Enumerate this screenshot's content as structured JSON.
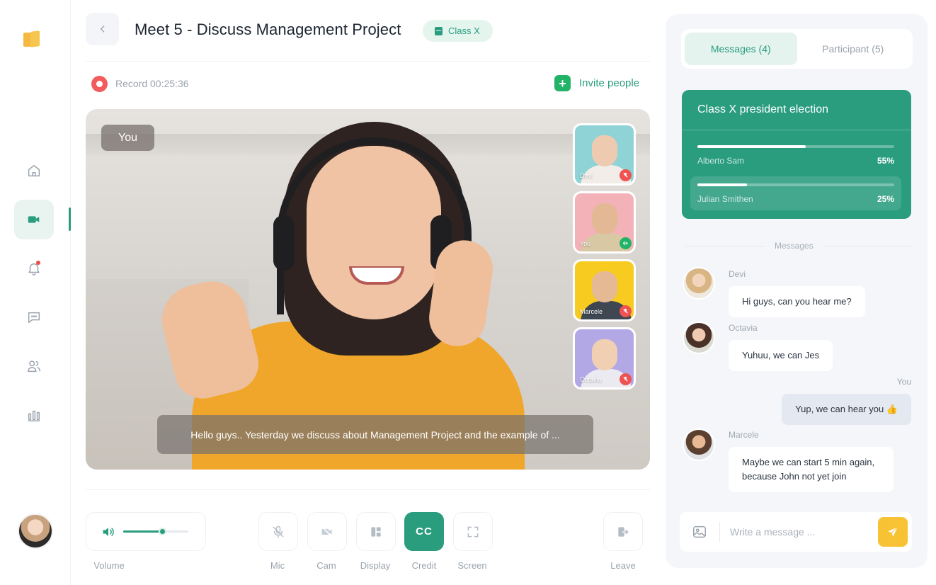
{
  "header": {
    "title": "Meet 5 - Discuss Management Project",
    "class_badge": "Class X"
  },
  "record": {
    "label": "Record 00:25:36"
  },
  "invite": {
    "label": "Invite people"
  },
  "video": {
    "self_label": "You",
    "caption": "Hello guys.. Yesterday we discuss about Management Project and the example of ...",
    "participants": [
      {
        "name": "Devi",
        "bg": "#8fd3d6",
        "status": "muted"
      },
      {
        "name": "You",
        "bg": "#f3b2b7",
        "status": "speaking"
      },
      {
        "name": "Marcele",
        "bg": "#f7cb1f",
        "status": "muted"
      },
      {
        "name": "Octavia",
        "bg": "#b3a8e6",
        "status": "muted"
      }
    ]
  },
  "controls": {
    "volume_label": "Volume",
    "volume_level": 0.6,
    "mic": "Mic",
    "cam": "Cam",
    "display": "Display",
    "credit": "Credit",
    "credit_icon_text": "CC",
    "screen": "Screen",
    "leave": "Leave"
  },
  "panel": {
    "tabs": [
      {
        "label": "Messages (4)",
        "active": true
      },
      {
        "label": "Participant (5)",
        "active": false
      }
    ],
    "poll": {
      "title": "Class X president election",
      "options": [
        {
          "name": "Alberto Sam",
          "percent": "55%",
          "value": 0.55
        },
        {
          "name": "Julian Smithen",
          "percent": "25%",
          "value": 0.25
        }
      ]
    },
    "messages_divider": "Messages",
    "messages": [
      {
        "sender": "Devi",
        "text": "Hi guys, can you hear me?",
        "mine": false
      },
      {
        "sender": "Octavia",
        "text": "Yuhuu, we can Jes",
        "mine": false
      },
      {
        "sender": "You",
        "text": "Yup, we can hear you 👍",
        "mine": true
      },
      {
        "sender": "Marcele",
        "text": "Maybe we can start 5 min again, because John not yet join",
        "mine": false
      }
    ],
    "compose": {
      "placeholder": "Write a message ..."
    }
  },
  "colors": {
    "accent": "#2a9d7f",
    "record": "#f25c5c",
    "send": "#f7c335"
  }
}
